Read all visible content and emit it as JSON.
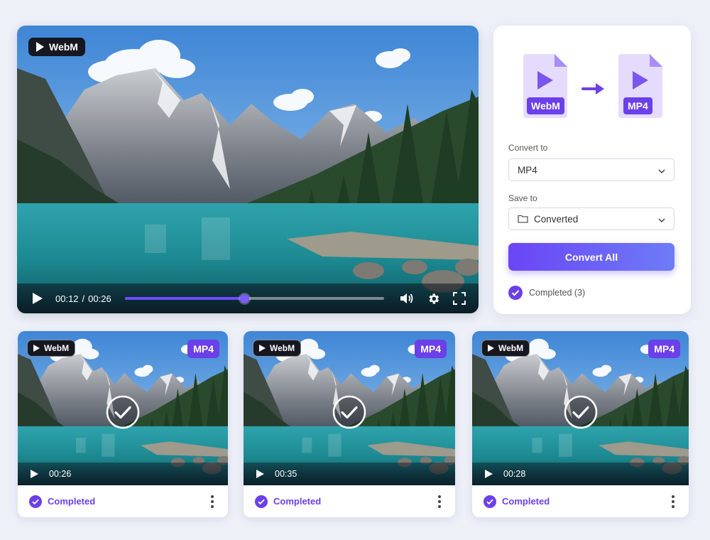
{
  "player": {
    "format_badge": "WebM",
    "current_time": "00:12",
    "separator": "/",
    "duration": "00:26",
    "progress_fraction": 0.46
  },
  "panel": {
    "source_format": "WebM",
    "target_format": "MP4",
    "convert_to_label": "Convert to",
    "convert_to_value": "MP4",
    "save_to_label": "Save to",
    "save_to_value": "Converted",
    "convert_button": "Convert All",
    "completed_summary": "Completed (3)"
  },
  "cards": [
    {
      "source": "WebM",
      "target": "MP4",
      "duration": "00:26",
      "status": "Completed"
    },
    {
      "source": "WebM",
      "target": "MP4",
      "duration": "00:35",
      "status": "Completed"
    },
    {
      "source": "WebM",
      "target": "MP4",
      "duration": "00:28",
      "status": "Completed"
    }
  ],
  "colors": {
    "accent": "#6b40e8",
    "background": "#eef0f8"
  },
  "icons": {
    "play": "play-icon",
    "volume": "volume-icon",
    "settings": "gear-icon",
    "fullscreen": "fullscreen-icon",
    "folder": "folder-icon",
    "chevron": "chevron-down-icon",
    "check": "check-circle-icon",
    "more": "more-vertical-icon"
  }
}
